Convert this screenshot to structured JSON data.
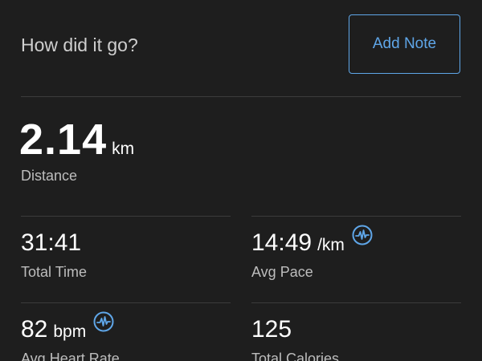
{
  "header": {
    "prompt": "How did it go?",
    "add_note_label": "Add Note"
  },
  "distance": {
    "value": "2.14",
    "unit": "km",
    "label": "Distance"
  },
  "stats": {
    "total_time": {
      "value": "31:41",
      "label": "Total Time"
    },
    "avg_pace": {
      "value": "14:49",
      "unit": "/km",
      "label": "Avg Pace",
      "icon": "heart-rate-pulse-icon"
    },
    "avg_heart_rate": {
      "value": "82",
      "unit": "bpm",
      "label": "Avg Heart Rate",
      "icon": "heart-rate-pulse-icon"
    },
    "total_calories": {
      "value": "125",
      "label": "Total Calories"
    }
  },
  "colors": {
    "background": "#1e1e1e",
    "accent": "#5fa6e8",
    "divider": "#3c3c3c",
    "label": "#bdbdbd"
  }
}
